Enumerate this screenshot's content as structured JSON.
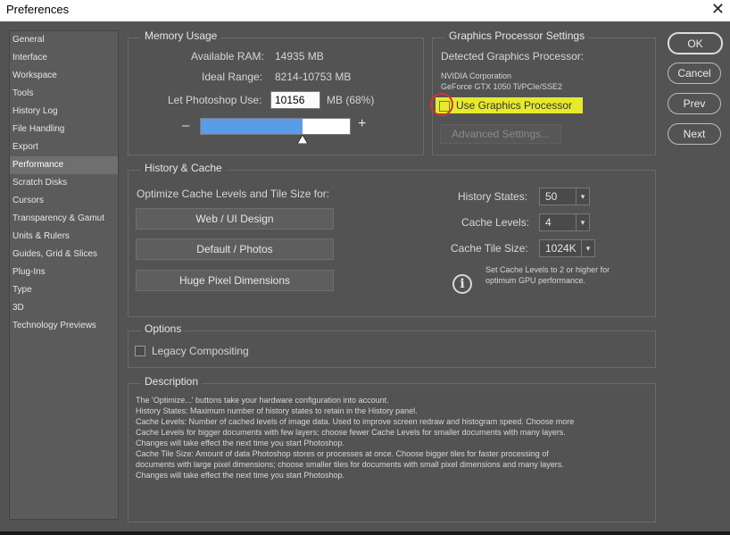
{
  "window": {
    "title": "Preferences",
    "close_glyph": "✕"
  },
  "sidebar": {
    "items": [
      {
        "label": "General"
      },
      {
        "label": "Interface"
      },
      {
        "label": "Workspace"
      },
      {
        "label": "Tools"
      },
      {
        "label": "History Log"
      },
      {
        "label": "File Handling"
      },
      {
        "label": "Export"
      },
      {
        "label": "Performance",
        "active": true
      },
      {
        "label": "Scratch Disks"
      },
      {
        "label": "Cursors"
      },
      {
        "label": "Transparency & Gamut"
      },
      {
        "label": "Units & Rulers"
      },
      {
        "label": "Guides, Grid & Slices"
      },
      {
        "label": "Plug-Ins"
      },
      {
        "label": "Type"
      },
      {
        "label": "3D"
      },
      {
        "label": "Technology Previews"
      }
    ]
  },
  "memory": {
    "title": "Memory Usage",
    "available_label": "Available RAM:",
    "available_value": "14935 MB",
    "ideal_label": "Ideal Range:",
    "ideal_value": "8214-10753 MB",
    "let_label": "Let Photoshop Use:",
    "let_value": "10156",
    "let_unit": "MB (68%)",
    "slider_fraction": 0.68,
    "minus": "–",
    "plus": "+"
  },
  "gpu": {
    "title": "Graphics Processor Settings",
    "detected_label": "Detected Graphics Processor:",
    "vendor": "NVIDIA Corporation",
    "model": "GeForce GTX 1050 Ti/PCIe/SSE2",
    "use_label": "Use Graphics Processor",
    "use_checked": false,
    "advanced_label": "Advanced Settings..."
  },
  "history_cache": {
    "title": "History & Cache",
    "optimize_label": "Optimize Cache Levels and Tile Size for:",
    "btn_web": "Web / UI Design",
    "btn_default": "Default / Photos",
    "btn_huge": "Huge Pixel Dimensions",
    "history_states_label": "History States:",
    "history_states_value": "50",
    "cache_levels_label": "Cache Levels:",
    "cache_levels_value": "4",
    "tile_size_label": "Cache Tile Size:",
    "tile_size_value": "1024K",
    "info_icon": "i",
    "info_text_1": "Set Cache Levels to 2 or higher for",
    "info_text_2": "optimum GPU performance."
  },
  "options": {
    "title": "Options",
    "legacy_label": "Legacy Compositing",
    "legacy_checked": false
  },
  "description": {
    "title": "Description",
    "text": "The 'Optimize...' buttons take your hardware configuration into account.\nHistory States: Maximum number of history states to retain in the History panel.\nCache Levels: Number of cached levels of image data.  Used to improve screen redraw and histogram speed.  Choose more\nCache Levels for bigger documents with few layers; choose fewer Cache Levels for smaller documents with many layers.\nChanges will take effect the next time you start Photoshop.\nCache Tile Size: Amount of data Photoshop stores or processes at once. Choose bigger tiles for faster processing of\ndocuments with large pixel dimensions; choose smaller tiles for documents with small pixel dimensions and many layers.\nChanges will take effect the next time you start Photoshop."
  },
  "actions": {
    "ok": "OK",
    "cancel": "Cancel",
    "prev": "Prev",
    "next": "Next"
  },
  "colors": {
    "slider_fill": "#5b9ce8",
    "highlight": "#e7ea2a",
    "annotation_circle": "#d0343c"
  }
}
